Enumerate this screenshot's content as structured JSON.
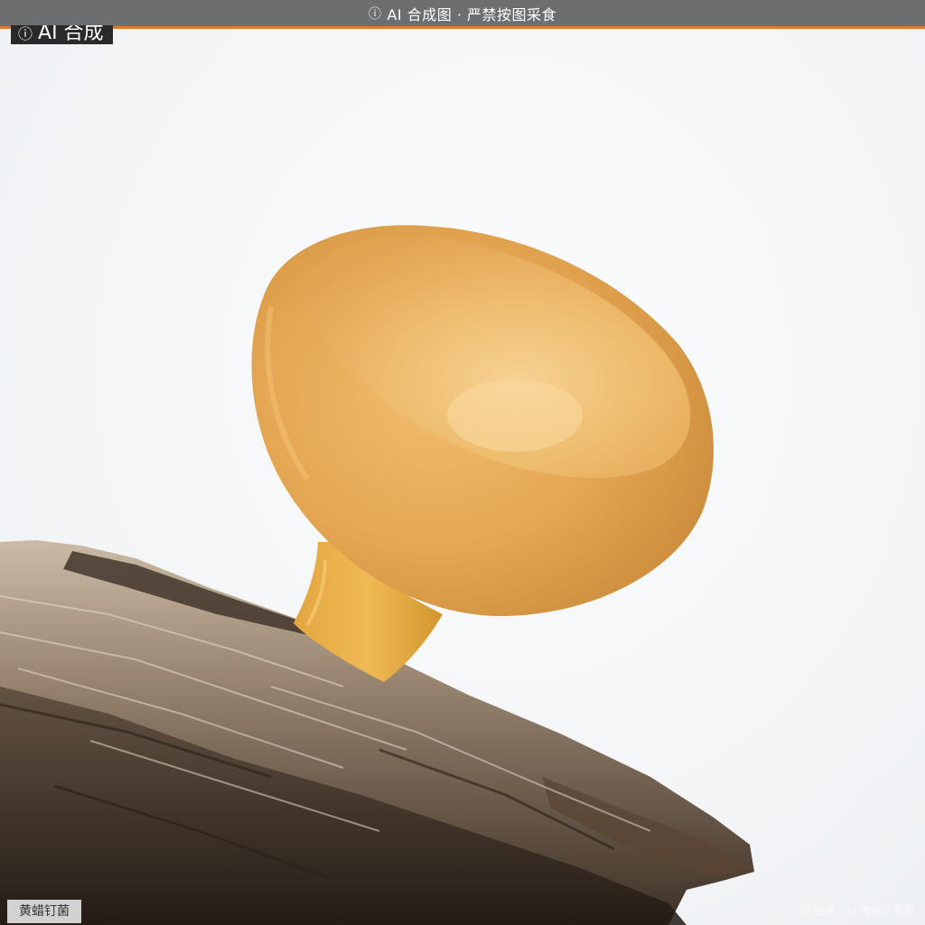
{
  "header": {
    "title": "AI 合成图 · 严禁按图采食",
    "icon": "info-icon"
  },
  "badge": {
    "label": "AI 合成",
    "icon": "info-icon"
  },
  "caption": {
    "label": "黄蜡钉菌"
  },
  "watermark": {
    "text": "© 拍摄 · AI 合成示意图"
  },
  "colors": {
    "bar": "#6d6e70",
    "accent": "#e07a2e",
    "mushroom": "#e3a64f",
    "background": "#f4f5f7"
  }
}
